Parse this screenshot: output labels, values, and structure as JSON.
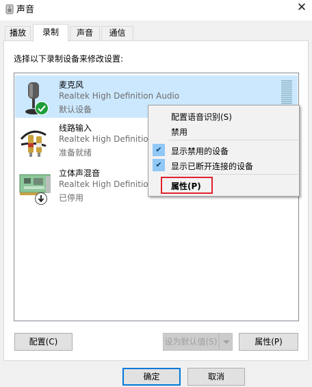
{
  "window": {
    "title": "声音"
  },
  "tabs": [
    {
      "label": "播放",
      "active": false
    },
    {
      "label": "录制",
      "active": true
    },
    {
      "label": "声音",
      "active": false
    },
    {
      "label": "通信",
      "active": false
    }
  ],
  "instruction": "选择以下录制设备来修改设置:",
  "devices": [
    {
      "name": "麦克风",
      "description": "Realtek High Definition Audio",
      "status": "默认设备",
      "selected": true,
      "icon": "microphone-icon",
      "badge": "default-check-icon"
    },
    {
      "name": "线路输入",
      "description": "Realtek High Definition Audio",
      "status": "准备就绪",
      "selected": false,
      "icon": "line-in-cable-icon"
    },
    {
      "name": "立体声混音",
      "description": "Realtek High Definition Audio",
      "status": "已停用",
      "selected": false,
      "icon": "sound-card-icon",
      "badge": "disabled-arrow-icon"
    }
  ],
  "context_menu": {
    "items": [
      {
        "label": "配置语音识别(S)",
        "checked": false
      },
      {
        "label": "禁用",
        "checked": false
      },
      {
        "label": "显示禁用的设备",
        "checked": true
      },
      {
        "label": "显示已断开连接的设备",
        "checked": true
      },
      {
        "label": "属性(P)",
        "checked": false,
        "bold": true,
        "highlighted": true
      }
    ]
  },
  "buttons": {
    "configure": "配置(C)",
    "set_default": "设为默认值(S)",
    "properties": "属性(P)",
    "ok": "确定",
    "cancel": "取消"
  },
  "colors": {
    "selection": "#cce8ff",
    "check_accent": "#90c8f6",
    "highlight_border": "#e0222c",
    "default_button_border": "#0078d7"
  }
}
